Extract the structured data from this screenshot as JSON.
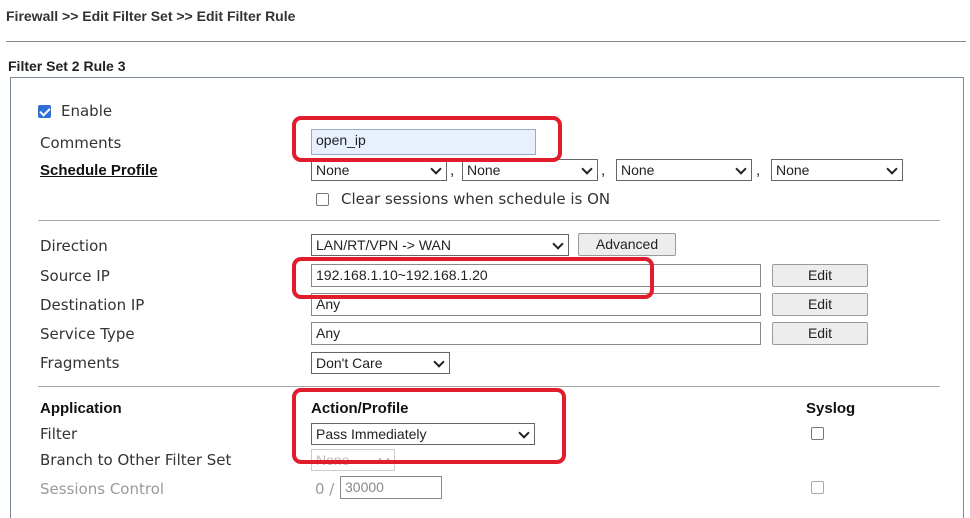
{
  "breadcrumb": "Firewall >> Edit Filter Set >> Edit Filter Rule",
  "section_title": "Filter Set 2 Rule 3",
  "enable": {
    "label": "Enable",
    "checked": true
  },
  "comments": {
    "label": "Comments",
    "value": "open_ip"
  },
  "schedule": {
    "label": "Schedule Profile",
    "selects": [
      "None",
      "None",
      "None",
      "None"
    ],
    "clear_label": "Clear sessions when schedule is ON"
  },
  "direction": {
    "label": "Direction",
    "value": "LAN/RT/VPN -> WAN",
    "advanced_label": "Advanced"
  },
  "source_ip": {
    "label": "Source IP",
    "value": "192.168.1.10~192.168.1.20",
    "edit_label": "Edit"
  },
  "destination_ip": {
    "label": "Destination IP",
    "value": "Any",
    "edit_label": "Edit"
  },
  "service_type": {
    "label": "Service Type",
    "value": "Any",
    "edit_label": "Edit"
  },
  "fragments": {
    "label": "Fragments",
    "value": "Don't Care"
  },
  "table_headers": {
    "application": "Application",
    "action_profile": "Action/Profile",
    "syslog": "Syslog"
  },
  "filter": {
    "label": "Filter",
    "value": "Pass Immediately"
  },
  "branch": {
    "label": "Branch to Other Filter Set",
    "value": "None"
  },
  "sessions": {
    "label": "Sessions Control",
    "current": "0 /",
    "limit": "30000"
  },
  "colors": {
    "highlight": "#e11d2c",
    "checkbox_accent": "#2f6fd6"
  }
}
